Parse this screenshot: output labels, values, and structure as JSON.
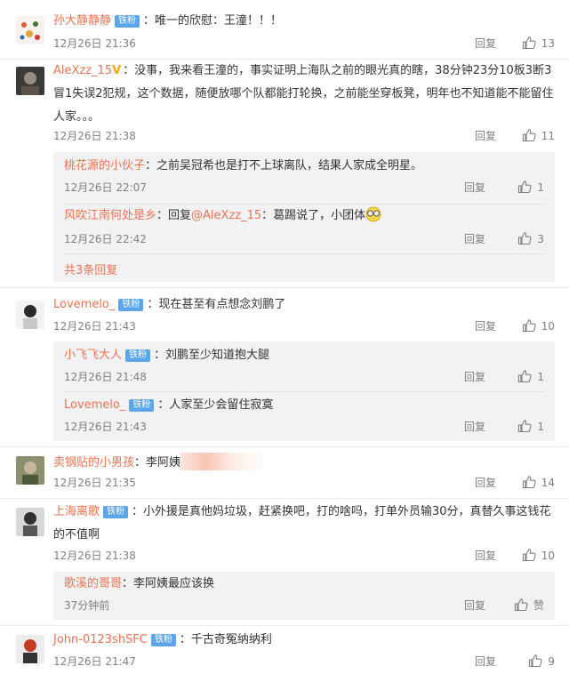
{
  "comments": [
    {
      "name": "孙大静静静",
      "badge": "铁粉",
      "text": "：唯一的欣慰：王潼！！！",
      "time": "12月26日 21:36",
      "reply": "回复",
      "likes": "13"
    },
    {
      "name": "AleXzz_15",
      "text_l1": "：没事，我来看王潼的，事实证明上海队之前的眼光真的瞎，38分钟23分10板3断3",
      "text_l2": "冒1失误2犯规，这个数据，随便放哪个队都能打轮换，之前能坐穿板凳，明年也不知道能不能留住",
      "text_l3": "人家。。。",
      "time": "12月26日 21:38",
      "reply": "回复",
      "likes": "11",
      "replies": [
        {
          "name": "桃花源的小伙子",
          "text": "：之前吴冠希也是打不上球离队，结果人家成全明星。",
          "time": "12月26日 22:07",
          "reply": "回复",
          "likes": "1"
        },
        {
          "name": "风吹江南何处是乡",
          "text_pre": "：回复",
          "mention": "@AleXzz_15",
          "text": "：葛踢说了，小团体",
          "time": "12月26日 22:42",
          "reply": "回复",
          "likes": "3"
        }
      ],
      "more": "共3条回复"
    },
    {
      "name": "Lovemelo_",
      "badge": "铁粉",
      "text": "：现在甚至有点想念刘鹏了",
      "time": "12月26日 21:43",
      "reply": "回复",
      "likes": "10",
      "replies": [
        {
          "name": "小飞飞大人",
          "badge": "铁粉",
          "text": "：刘鹏至少知道抱大腿",
          "time": "12月26日 21:48",
          "reply": "回复",
          "likes": "1"
        },
        {
          "name": "Lovemelo_",
          "badge": "铁粉",
          "text": "：人家至少会留住寂寞",
          "time": "12月26日 21:43",
          "reply": "回复",
          "likes": "1"
        }
      ]
    },
    {
      "name": "卖钢贴的小男孩",
      "text": "：李阿姨",
      "time": "12月26日 21:35",
      "reply": "回复",
      "likes": "14"
    },
    {
      "name": "上海离歌",
      "badge": "铁粉",
      "text_l1": "：小外援是真他妈垃圾，赶紧换吧，打的啥吗，打单外员输30分，真替久事这钱花",
      "text_l2": "的不值啊",
      "time": "12月26日 21:38",
      "reply": "回复",
      "likes": "10",
      "replies": [
        {
          "name": "歌溪的哥哥",
          "text": "：李阿姨最应该换",
          "time": "37分钟前",
          "reply": "回复",
          "likes": "赞"
        }
      ]
    },
    {
      "name": "John-0123shSFC",
      "badge": "铁粉",
      "text": "：千古奇冤纳纳利",
      "time": "12月26日 21:47",
      "reply": "回复",
      "likes": "9"
    }
  ],
  "colors": {
    "name": "#eb7350",
    "badge": "#5aa6e8",
    "vip": "#f6a716",
    "text": "#333333",
    "meta": "#808080",
    "sub_bg": "#f2f2f5"
  }
}
